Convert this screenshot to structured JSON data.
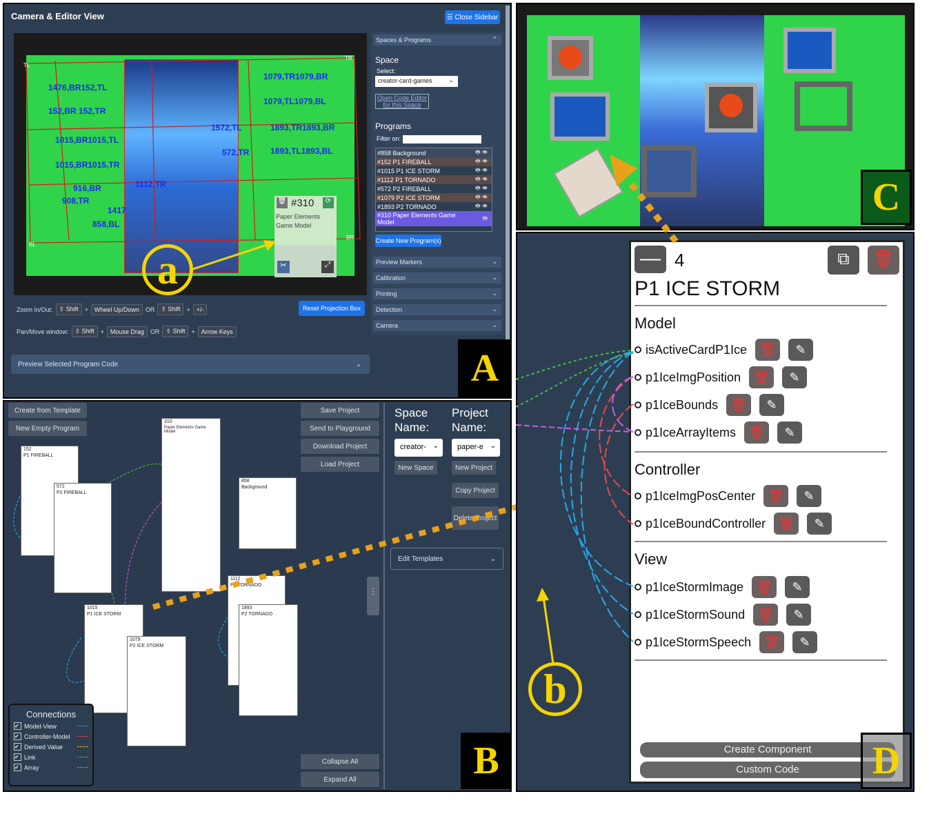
{
  "panelA": {
    "title": "Camera & Editor View",
    "close_sidebar": "☰ Close Sidebar",
    "spaces_programs": "Spaces & Programs",
    "space_heading": "Space",
    "select_label": "Select:",
    "select_value": "creator-card-games",
    "open_code_editor": "Open Code Editor for this Space",
    "programs_heading": "Programs",
    "filter_label": "Filter on:",
    "programs": [
      "#858 Background",
      "#152 P1 FIREBALL",
      "#1015 P1 ICE STORM",
      "#1112 P1 TORNADO",
      "#572 P2 FIREBALL",
      "#1079 P2 ICE STORM",
      "#1893 P2 TORNADO",
      "#310 Paper Elements Game Model"
    ],
    "create_new_program": "Create New Program(s)",
    "accordions": [
      "Preview Markers",
      "Calibration",
      "Printing",
      "Detection",
      "Camera"
    ],
    "zoom_label": "Zoom In/Out:",
    "zoom_keys": [
      "⇧ Shift",
      "Wheel Up/Down",
      "OR",
      "⇧ Shift",
      "+/-"
    ],
    "pan_label": "Pan/Move window:",
    "pan_keys": [
      "⇧ Shift",
      "Mouse Drag",
      "OR",
      "⇧ Shift",
      "Arrow Keys"
    ],
    "reset_projection": "Reset Projection Box",
    "preview_code": "Preview Selected Program Code",
    "overlay_id": "#310",
    "overlay_text": "Paper Elements Game Model",
    "corner_labels": [
      "TL",
      "TR",
      "BL",
      "BR"
    ],
    "marker_labels": [
      "1476,BR152,TL",
      "152,BR 152,TR",
      "1015,BR1015,TL",
      "1015,BR1015,TR",
      "1079,TR1079,BR",
      "1079,TL1079,BL",
      "1572,TL",
      "572,TR",
      "1893,TR1893,BR",
      "1893,TL1893,BL",
      "916,BR",
      "908,TR",
      "1417",
      "858,BL",
      "1112,TR"
    ]
  },
  "panelB": {
    "left_buttons": [
      "Create from Template",
      "New Empty Program"
    ],
    "right_buttons": [
      "Save Project",
      "Send to Playground",
      "Download Project",
      "Load Project"
    ],
    "bottom_buttons": [
      "Collapse All",
      "Expand All"
    ],
    "space_name_label": "Space Name:",
    "project_name_label": "Project Name:",
    "space_value": "creator-",
    "project_value": "paper-e",
    "new_space": "New Space",
    "new_project": "New Project",
    "copy_project": "Copy Project",
    "delete_project": "Delete Project",
    "edit_templates": "Edit Templates",
    "cards": [
      {
        "id": "152",
        "name": "P1 FIREBALL"
      },
      {
        "id": "572",
        "name": "P2 FIREBALL"
      },
      {
        "id": "310",
        "name": "Paper Elements Game Model"
      },
      {
        "id": "858",
        "name": "Background"
      },
      {
        "id": "1112",
        "name": "P1 TORNADO"
      },
      {
        "id": "1893",
        "name": "P2 TORNADO"
      },
      {
        "id": "1015",
        "name": "P1 ICE STORM"
      },
      {
        "id": "1079",
        "name": "P2 ICE STORM"
      }
    ],
    "connections_title": "Connections",
    "connections": [
      {
        "label": "Model-View",
        "color": "#27a9e8"
      },
      {
        "label": "Controller-Model",
        "color": "#e84a4a"
      },
      {
        "label": "Derived Value",
        "color": "#f5c400"
      },
      {
        "label": "Link",
        "color": "#3fc43f"
      },
      {
        "label": "Array",
        "color": "#c860e0"
      }
    ]
  },
  "panelD": {
    "count": "4",
    "title": "P1 ICE STORM",
    "model_heading": "Model",
    "model_items": [
      "isActiveCardP1Ice",
      "p1IceImgPosition",
      "p1IceBounds",
      "p1IceArrayItems"
    ],
    "controller_heading": "Controller",
    "controller_items": [
      "p1IceImgPosCenter",
      "p1IceBoundController"
    ],
    "view_heading": "View",
    "view_items": [
      "p1IceStormImage",
      "p1IceStormSound",
      "p1IceStormSpeech"
    ],
    "create_component": "Create Component",
    "custom_code": "Custom Code"
  },
  "labels": {
    "A": "A",
    "B": "B",
    "C": "C",
    "D": "D",
    "a": "a",
    "b": "b"
  },
  "colors": {
    "green_table": "#2fd44a",
    "panel": "#2e3e52",
    "accent": "#1e73e8",
    "annotation": "#f5d400",
    "arrow_orange": "#e8a21a"
  }
}
